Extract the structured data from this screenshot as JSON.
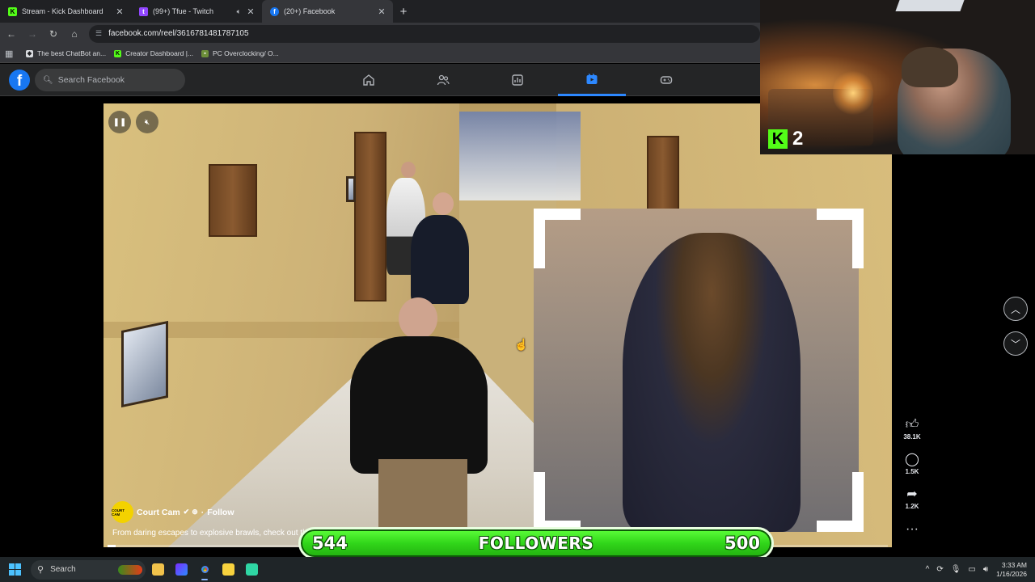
{
  "browser": {
    "tabs": [
      {
        "label": "Stream - Kick Dashboard",
        "icon": "kick-icon",
        "color": "#53fc18",
        "active": false
      },
      {
        "label": "(99+) Tfue - Twitch",
        "icon": "twitch-icon",
        "color": "#9146ff",
        "active": false,
        "muted": true
      },
      {
        "label": "(20+) Facebook",
        "icon": "facebook-icon",
        "color": "#1877f2",
        "active": true
      }
    ],
    "url": "facebook.com/reel/3616781481787105",
    "bookmarks": [
      {
        "label": "The best ChatBot an...",
        "icon": "chatbot-icon"
      },
      {
        "label": "Creator Dashboard |...",
        "icon": "kick-icon"
      },
      {
        "label": "PC Overclocking/ O...",
        "icon": "overclock-icon"
      }
    ]
  },
  "facebook": {
    "search_placeholder": "Search Facebook",
    "nav": [
      "home-icon",
      "friends-icon",
      "dashboard-icon",
      "video-icon",
      "gaming-icon"
    ],
    "active_nav": "video-icon"
  },
  "reel": {
    "channel_name": "Court Cam",
    "channel_avatar_text": "COURT CAM",
    "follow_label": "Follow",
    "dot": "·",
    "caption": "From daring escapes to explosive brawls, check out th",
    "progress_fraction": 0.01,
    "likes": "38.1K",
    "comments": "1.5K",
    "shares": "1.2K"
  },
  "webcam": {
    "kick_count": "2"
  },
  "goal": {
    "current": "544",
    "label": "FOLLOWERS",
    "target": "500"
  },
  "taskbar": {
    "search_label": "Search",
    "time": "3:33 AM",
    "date": "1/16/2026"
  }
}
